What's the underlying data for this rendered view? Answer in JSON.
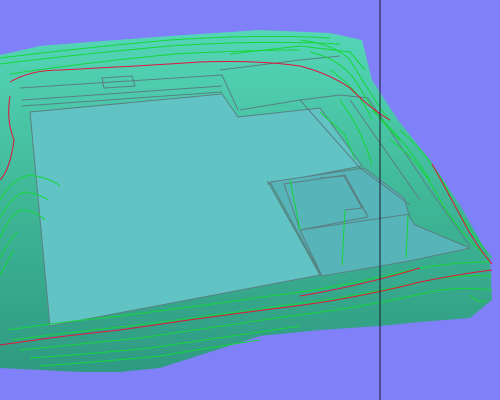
{
  "colors": {
    "background": "#8080f8",
    "terrain": "#3fae95",
    "terrain_light": "#4fc0a6",
    "pad": "#62c3c4",
    "pad_shade": "#57b4b8",
    "pad_edge": "#5a7f83",
    "contour_minor": "#17d63a",
    "contour_major": "#e0143c",
    "probe_line": "#1a1a2e"
  },
  "icons": {
    "terrain": "terrain-mesh-icon",
    "probe": "vertical-probe-line-icon"
  }
}
